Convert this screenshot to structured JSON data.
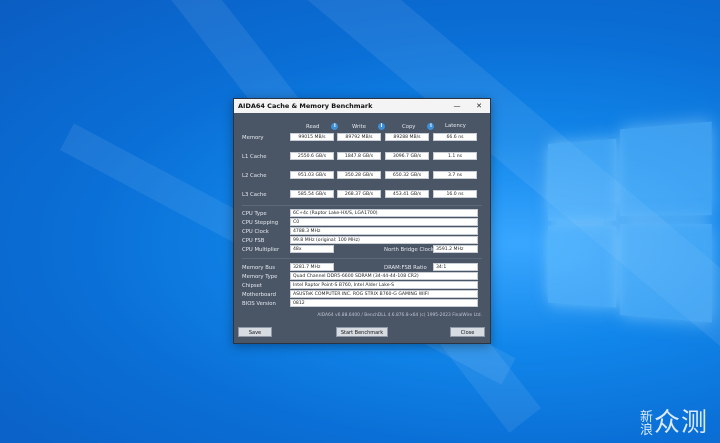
{
  "window": {
    "title": "AIDA64 Cache & Memory Benchmark",
    "minimize": "—",
    "close": "✕"
  },
  "columns": {
    "read": "Read",
    "write": "Write",
    "copy": "Copy",
    "latency": "Latency"
  },
  "rows": [
    {
      "label": "Memory",
      "read": "99015 MB/s",
      "write": "89792 MB/s",
      "copy": "89288 MB/s",
      "latency": "66.6 ns"
    },
    {
      "label": "L1 Cache",
      "read": "2550.6 GB/s",
      "write": "1847.8 GB/s",
      "copy": "3096.7 GB/s",
      "latency": "1.1 ns"
    },
    {
      "label": "L2 Cache",
      "read": "951.03 GB/s",
      "write": "350.28 GB/s",
      "copy": "650.32 GB/s",
      "latency": "3.7 ns"
    },
    {
      "label": "L3 Cache",
      "read": "585.54 GB/s",
      "write": "268.37 GB/s",
      "copy": "453.41 GB/s",
      "latency": "16.0 ns"
    }
  ],
  "cpu": {
    "type_label": "CPU Type",
    "type_value": "6C+4c  (Raptor Lake-HX/S, LGA1700)",
    "stepping_label": "CPU Stepping",
    "stepping_value": "C0",
    "clock_label": "CPU Clock",
    "clock_value": "4788.3 MHz",
    "fsb_label": "CPU FSB",
    "fsb_value": "99.8 MHz  (original: 100 MHz)",
    "multiplier_label": "CPU Multiplier",
    "multiplier_value": "48x",
    "nb_clock_label": "North Bridge Clock",
    "nb_clock_value": "3591.2 MHz"
  },
  "memory": {
    "bus_label": "Memory Bus",
    "bus_value": "3281.7 MHz",
    "ratio_label": "DRAM:FSB Ratio",
    "ratio_value": "34:1",
    "type_label": "Memory Type",
    "type_value": "Quad Channel DDR5-6600 SDRAM  (34-44-44-108 CR2)",
    "chipset_label": "Chipset",
    "chipset_value": "Intel Raptor Point-S B760, Intel Alder Lake-S",
    "motherboard_label": "Motherboard",
    "motherboard_value": "ASUSTeK COMPUTER INC. ROG STRIX B760-G GAMING WIFI",
    "bios_label": "BIOS Version",
    "bios_value": "0812"
  },
  "footer": "AIDA64 v6.88.6400 / BenchDLL 4.6.876.8-x64  (c) 1995-2023 FinalWire Ltd.",
  "buttons": {
    "save": "Save",
    "start": "Start Benchmark",
    "close": "Close"
  },
  "watermark": {
    "small_text": "新浪",
    "large_text": "众测"
  },
  "colors": {
    "desktop": "#0a6fd6",
    "window_bg": "#4a5566",
    "info_icon": "#3d8fd8"
  }
}
